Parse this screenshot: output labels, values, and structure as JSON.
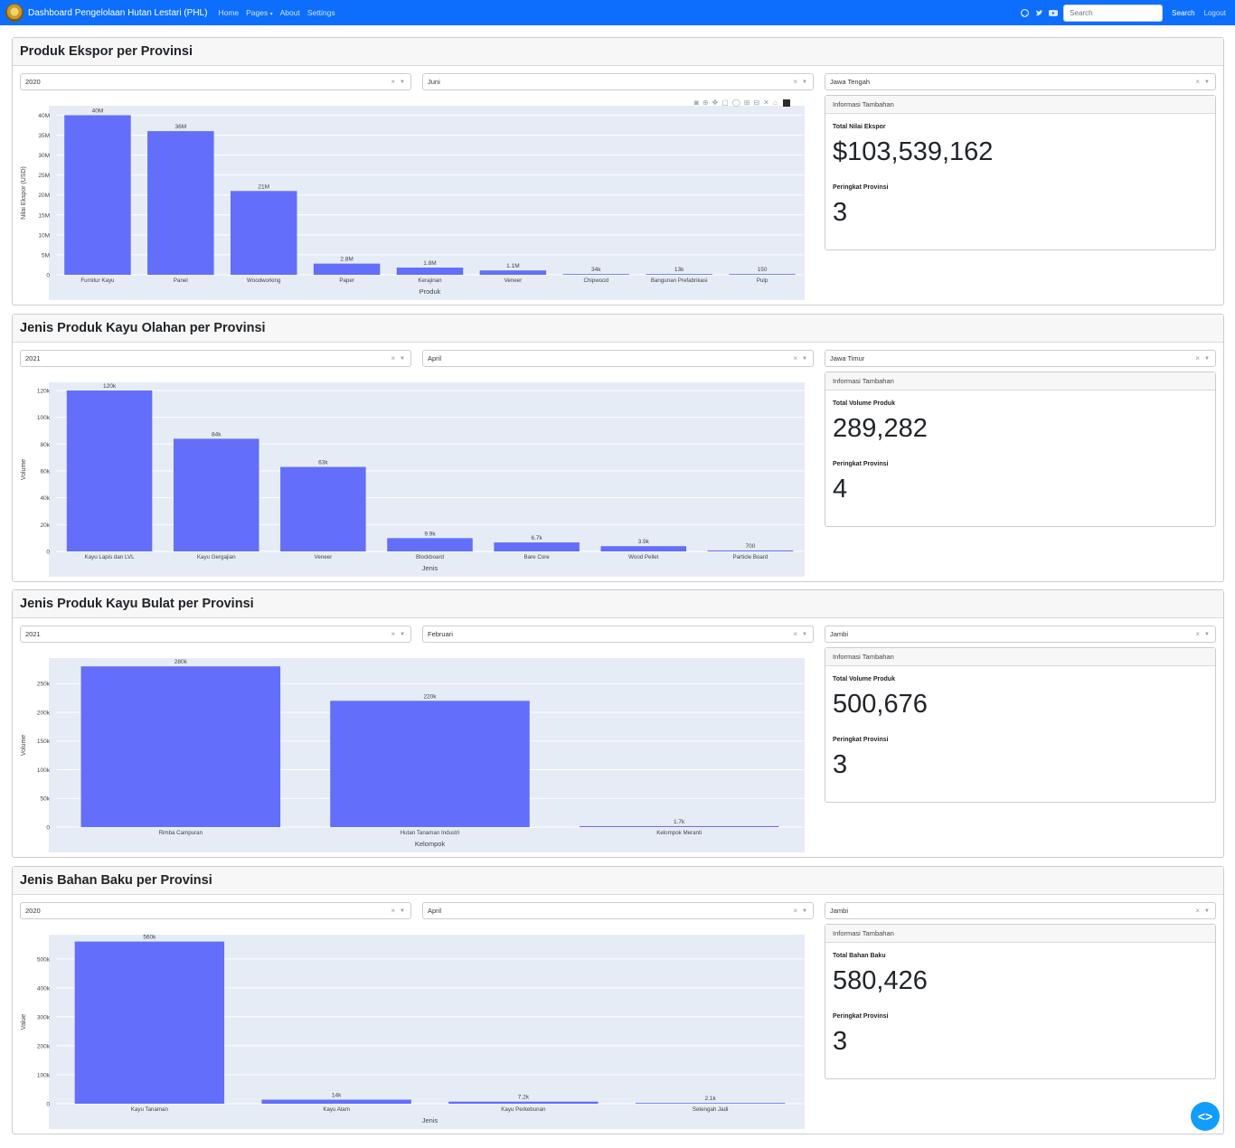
{
  "navbar": {
    "brand": "Dashboard Pengelolaan Hutan Lestari (PHL)",
    "links": [
      "Home",
      "Pages",
      "About",
      "Settings"
    ],
    "pages_caret": "▾",
    "search_placeholder": "Search",
    "search_button": "Search",
    "logout": "Logout",
    "social_icons": [
      "github-icon",
      "twitter-icon",
      "youtube-icon"
    ],
    "color": "#0d6efd"
  },
  "sections": [
    {
      "title": "Produk Ekspor per Provinsi",
      "filters": {
        "year": "2020",
        "month": "Juni",
        "province": "Jawa Tengah"
      },
      "info": {
        "header": "Informasi Tambahan",
        "total_label": "Total Nilai Ekspor",
        "total_value": "$103,539,162",
        "rank_label": "Peringkat Provinsi",
        "rank_value": "3"
      }
    },
    {
      "title": "Jenis Produk Kayu Olahan per Provinsi",
      "filters": {
        "year": "2021",
        "month": "April",
        "province": "Jawa Timur"
      },
      "info": {
        "header": "Informasi Tambahan",
        "total_label": "Total Volume Produk",
        "total_value": "289,282",
        "rank_label": "Peringkat Provinsi",
        "rank_value": "4"
      }
    },
    {
      "title": "Jenis Produk Kayu Bulat per Provinsi",
      "filters": {
        "year": "2021",
        "month": "Februari",
        "province": "Jambi"
      },
      "info": {
        "header": "Informasi Tambahan",
        "total_label": "Total Volume Produk",
        "total_value": "500,676",
        "rank_label": "Peringkat Provinsi",
        "rank_value": "3"
      }
    },
    {
      "title": "Jenis Bahan Baku per Provinsi",
      "filters": {
        "year": "2020",
        "month": "April",
        "province": "Jambi"
      },
      "info": {
        "header": "Informasi Tambahan",
        "total_label": "Total Bahan Baku",
        "total_value": "580,426",
        "rank_label": "Peringkat Provinsi",
        "rank_value": "3"
      }
    }
  ],
  "dropdown_clear": "×",
  "dropdown_arrow": "▼",
  "fab_label": "<>",
  "bar_color": "#636efa",
  "plot_bg": "#e5ecf6",
  "chart_data": [
    {
      "type": "bar",
      "categories": [
        "Furnitur Kayu",
        "Panel",
        "Woodworking",
        "Paper",
        "Kerajinan",
        "Veneer",
        "Chipwood",
        "Bangunan Prefabrikasi",
        "Pulp"
      ],
      "values": [
        40000000,
        36000000,
        21000000,
        2800000,
        1800000,
        1100000,
        34000,
        13000,
        150
      ],
      "labels": [
        "40M",
        "36M",
        "21M",
        "2.8M",
        "1.8M",
        "1.1M",
        "34k",
        "13k",
        "150"
      ],
      "xlabel": "Produk",
      "ylabel": "Nilai Ekspor (USD)",
      "ylim": [
        0,
        41000000
      ],
      "yticks": [
        0,
        5000000,
        10000000,
        15000000,
        20000000,
        25000000,
        30000000,
        35000000,
        40000000
      ],
      "yticklabels": [
        "0",
        "5M",
        "10M",
        "15M",
        "20M",
        "25M",
        "30M",
        "35M",
        "40M"
      ],
      "grid": true,
      "show_modebar": true
    },
    {
      "type": "bar",
      "categories": [
        "Kayu Lapis dan LVL",
        "Kayu Gergajian",
        "Veneer",
        "Blockboard",
        "Bare Core",
        "Wood Pellet",
        "Particle Board"
      ],
      "values": [
        120000,
        84000,
        63000,
        9900,
        6700,
        3900,
        700
      ],
      "labels": [
        "120k",
        "84k",
        "63k",
        "9.9k",
        "6.7k",
        "3.9k",
        "700"
      ],
      "xlabel": "Jenis",
      "ylabel": "Volume",
      "ylim": [
        0,
        122000
      ],
      "yticks": [
        0,
        20000,
        40000,
        60000,
        80000,
        100000,
        120000
      ],
      "yticklabels": [
        "0",
        "20k",
        "40k",
        "60k",
        "80k",
        "100k",
        "120k"
      ],
      "grid": true,
      "show_modebar": false
    },
    {
      "type": "bar",
      "categories": [
        "Rimba Campuran",
        "Hutan Tanaman Industri",
        "Kelompok Meranti"
      ],
      "values": [
        280000,
        220000,
        1700
      ],
      "labels": [
        "280k",
        "220k",
        "1.7k"
      ],
      "xlabel": "Kelompok",
      "ylabel": "Volume",
      "ylim": [
        0,
        285000
      ],
      "yticks": [
        0,
        50000,
        100000,
        150000,
        200000,
        250000
      ],
      "yticklabels": [
        "0",
        "50k",
        "100k",
        "150k",
        "200k",
        "250k"
      ],
      "grid": true,
      "show_modebar": false
    },
    {
      "type": "bar",
      "categories": [
        "Kayu Tanaman",
        "Kayu Alam",
        "Kayu Perkebunan",
        "Setengah Jadi"
      ],
      "values": [
        560000,
        14000,
        7200,
        2100
      ],
      "labels": [
        "560k",
        "14k",
        "7.2k",
        "2.1k"
      ],
      "xlabel": "Jenis",
      "ylabel": "Value",
      "ylim": [
        0,
        565000
      ],
      "yticks": [
        0,
        100000,
        200000,
        300000,
        400000,
        500000
      ],
      "yticklabels": [
        "0",
        "100k",
        "200k",
        "300k",
        "400k",
        "500k"
      ],
      "grid": true,
      "show_modebar": false
    }
  ]
}
